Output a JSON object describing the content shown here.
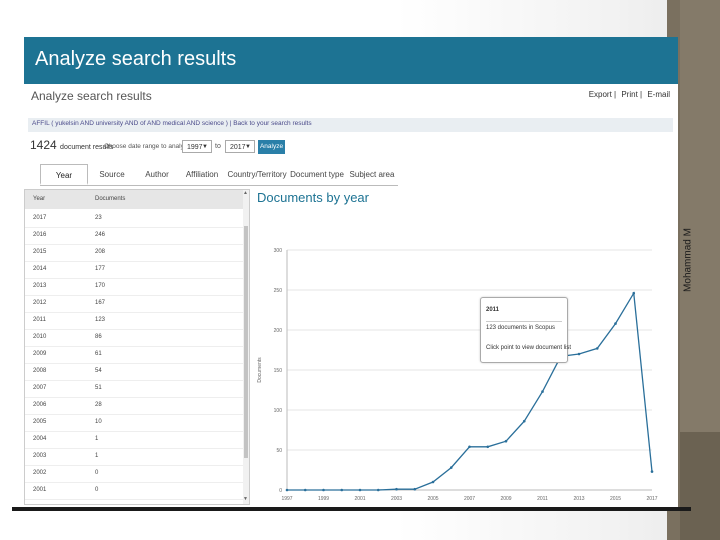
{
  "side_label": "Mohammad M",
  "banner_title": "Analyze search results",
  "page_title": "Analyze search results",
  "export": {
    "export_label": "Export",
    "print_label": "Print",
    "email_label": "E-mail"
  },
  "query": {
    "text": "AFFIL ( yukelsin AND university AND of AND medical AND science )",
    "back_label": "Back to your search results"
  },
  "results": {
    "count": "1424",
    "count_suffix": "document results",
    "range_prompt": "Choose date range to analyze:",
    "from_year": "1997",
    "to_label": "to",
    "to_year": "2017",
    "analyze_label": "Analyze"
  },
  "tabs": [
    "Year",
    "Source",
    "Author",
    "Affiliation",
    "Country/Territory",
    "Document type",
    "Subject area"
  ],
  "active_tab": "Year",
  "table": {
    "headers": [
      "Year",
      "Documents"
    ],
    "rows": [
      {
        "year": "2017",
        "docs": "23"
      },
      {
        "year": "2016",
        "docs": "246"
      },
      {
        "year": "2015",
        "docs": "208"
      },
      {
        "year": "2014",
        "docs": "177"
      },
      {
        "year": "2013",
        "docs": "170"
      },
      {
        "year": "2012",
        "docs": "167"
      },
      {
        "year": "2011",
        "docs": "123"
      },
      {
        "year": "2010",
        "docs": "86"
      },
      {
        "year": "2009",
        "docs": "61"
      },
      {
        "year": "2008",
        "docs": "54"
      },
      {
        "year": "2007",
        "docs": "51"
      },
      {
        "year": "2006",
        "docs": "28"
      },
      {
        "year": "2005",
        "docs": "10"
      },
      {
        "year": "2004",
        "docs": "1"
      },
      {
        "year": "2003",
        "docs": "1"
      },
      {
        "year": "2002",
        "docs": "0"
      },
      {
        "year": "2001",
        "docs": "0"
      }
    ]
  },
  "tooltip": {
    "year": "2011",
    "docs": "123 documents in Scopus",
    "click": "Click point to view document list"
  },
  "accent_color": "#1d7393",
  "chart_data": {
    "type": "line",
    "title": "Documents by year",
    "xlabel": "",
    "ylabel": "Documents",
    "x": [
      1997,
      1998,
      1999,
      2000,
      2001,
      2002,
      2003,
      2004,
      2005,
      2006,
      2007,
      2008,
      2009,
      2010,
      2011,
      2012,
      2013,
      2014,
      2015,
      2016,
      2017
    ],
    "series": [
      {
        "values": [
          0,
          0,
          0,
          0,
          0,
          0,
          1,
          1,
          10,
          28,
          54,
          54,
          61,
          86,
          123,
          167,
          170,
          177,
          208,
          246,
          23
        ]
      }
    ],
    "xticks": [
      "1997",
      "1999",
      "2001",
      "2003",
      "2005",
      "2007",
      "2009",
      "2011",
      "2013",
      "2015",
      "2017"
    ],
    "yticks": [
      "0",
      "50",
      "100",
      "150",
      "200",
      "250",
      "300"
    ],
    "ylim": [
      0,
      300
    ],
    "grid": true,
    "line_color": "#2a6f9a"
  }
}
